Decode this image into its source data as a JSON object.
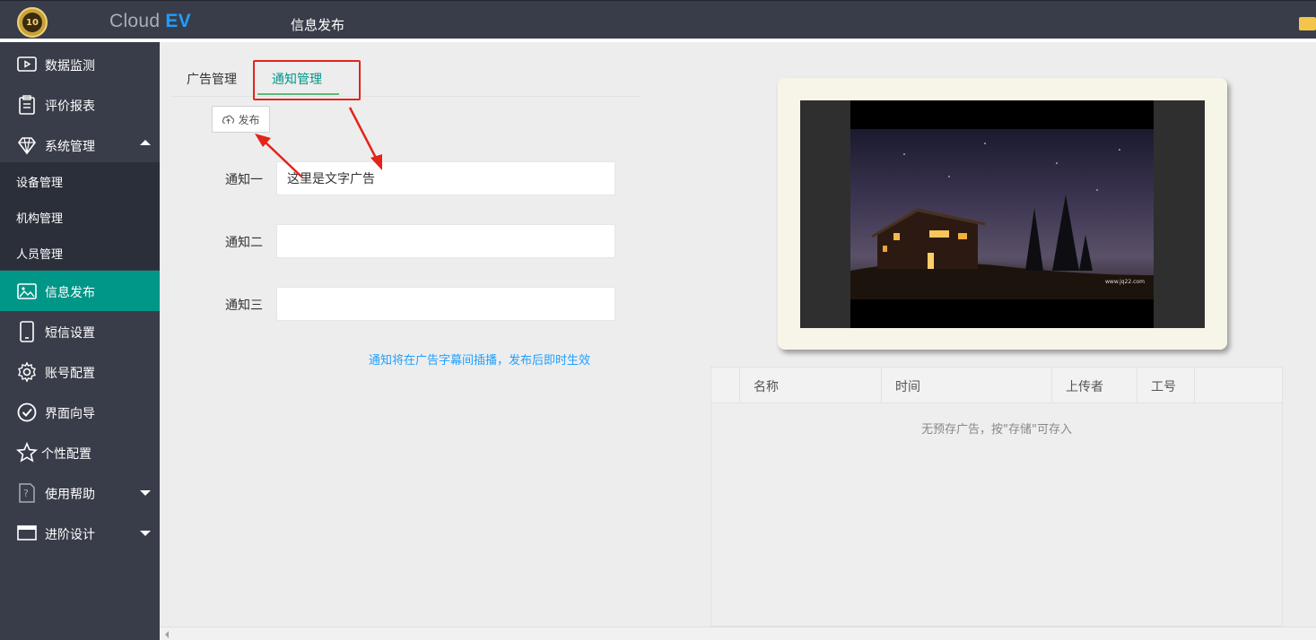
{
  "header": {
    "brand_prefix": "Cloud",
    "brand_suffix": "EV",
    "logo_text": "10",
    "page_title": "信息发布"
  },
  "sidebar": {
    "items": [
      {
        "label": "数据监测",
        "icon": "video-icon"
      },
      {
        "label": "评价报表",
        "icon": "clipboard-icon"
      },
      {
        "label": "系统管理",
        "icon": "diamond-icon",
        "expanded": true
      },
      {
        "label": "信息发布",
        "icon": "image-icon",
        "active": true
      },
      {
        "label": "短信设置",
        "icon": "phone-icon"
      },
      {
        "label": "账号配置",
        "icon": "gear-icon"
      },
      {
        "label": "界面向导",
        "icon": "check-circle-icon"
      },
      {
        "label": "个性配置",
        "icon": "star-icon"
      },
      {
        "label": "使用帮助",
        "icon": "help-icon",
        "has_children": true
      },
      {
        "label": "进阶设计",
        "icon": "window-icon",
        "has_children": true
      }
    ],
    "sub_items": [
      {
        "label": "设备管理"
      },
      {
        "label": "机构管理"
      },
      {
        "label": "人员管理"
      }
    ]
  },
  "tabs": [
    {
      "label": "广告管理",
      "selected": false
    },
    {
      "label": "通知管理",
      "selected": true
    }
  ],
  "publish_button": {
    "label": "发布",
    "icon": "cloud-upload-icon"
  },
  "form": {
    "fields": [
      {
        "label": "通知一",
        "value": "这里是文字广告"
      },
      {
        "label": "通知二",
        "value": ""
      },
      {
        "label": "通知三",
        "value": ""
      }
    ],
    "hint": "通知将在广告字幕间插播，发布后即时生效"
  },
  "preview": {
    "watermark": "www.jq22.com"
  },
  "table": {
    "columns": [
      "名称",
      "时间",
      "上传者",
      "工号"
    ],
    "empty_text": "无预存广告，按\"存储\"可存入"
  },
  "colors": {
    "topbar": "#393d49",
    "sidebar": "#393d49",
    "active": "#009688",
    "accent_blue": "#1e9fff",
    "annotation_red": "#e4231a"
  }
}
